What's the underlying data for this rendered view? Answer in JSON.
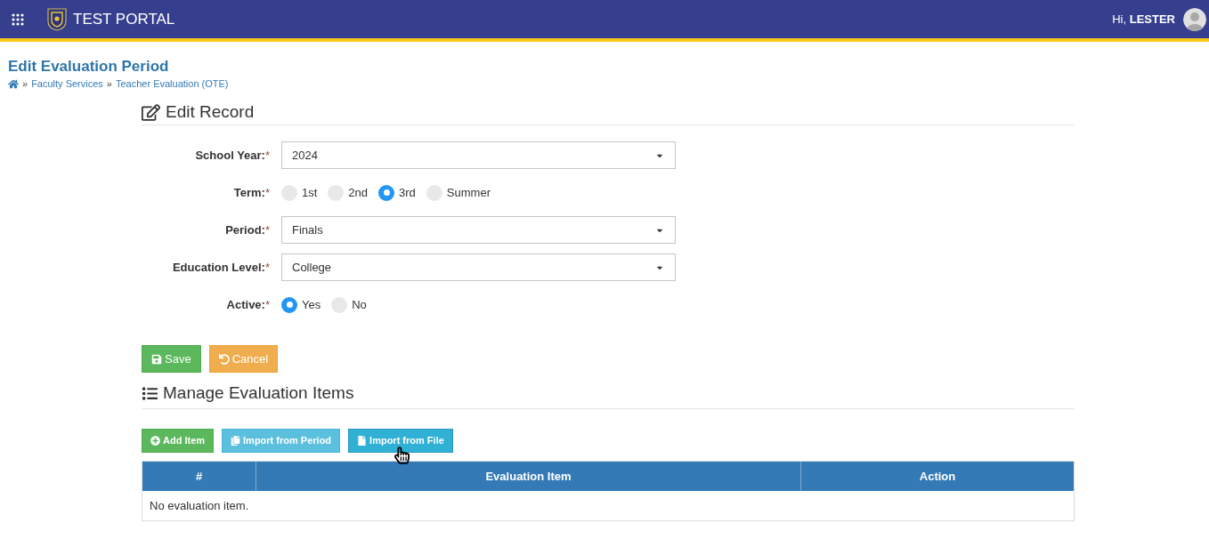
{
  "header": {
    "title": "TEST PORTAL",
    "greeting": "Hi,",
    "user": "LESTER"
  },
  "page": {
    "title": "Edit Evaluation Period",
    "breadcrumb": [
      {
        "kind": "home"
      },
      {
        "kind": "link",
        "separator": "»",
        "label": "Faculty Services"
      },
      {
        "kind": "link",
        "separator": "»",
        "label": "Teacher Evaluation (OTE)"
      }
    ]
  },
  "edit_record": {
    "title": "Edit Record",
    "fields": [
      {
        "kind": "select",
        "label": "School Year:",
        "required_mark": "*",
        "value": "2024"
      },
      {
        "kind": "radio",
        "label": "Term:",
        "required_mark": "*",
        "options": [
          {
            "label": "1st",
            "selected": false
          },
          {
            "label": "2nd",
            "selected": false
          },
          {
            "label": "3rd",
            "selected": true
          },
          {
            "label": "Summer",
            "selected": false
          }
        ]
      },
      {
        "kind": "select",
        "label": "Period:",
        "required_mark": "*",
        "value": "Finals"
      },
      {
        "kind": "select",
        "label": "Education Level:",
        "required_mark": "*",
        "value": "College"
      },
      {
        "kind": "radio",
        "label": "Active:",
        "required_mark": "*",
        "options": [
          {
            "label": "Yes",
            "selected": true
          },
          {
            "label": "No",
            "selected": false
          }
        ]
      }
    ],
    "buttons": [
      {
        "kind": "save",
        "label": "Save",
        "hovered": false
      },
      {
        "kind": "cancel",
        "label": "Cancel",
        "hovered": false
      }
    ]
  },
  "evaluation_items": {
    "title": "Manage Evaluation Items",
    "buttons": [
      {
        "kind": "add",
        "label": "Add Item",
        "hovered": false
      },
      {
        "kind": "import_period",
        "label": "Import from Period",
        "hovered": false
      },
      {
        "kind": "import_file",
        "label": "Import from File",
        "hovered": true
      }
    ],
    "table": {
      "columns": [
        "#",
        "Evaluation Item",
        "Action"
      ],
      "empty_text": "No evaluation item."
    }
  }
}
